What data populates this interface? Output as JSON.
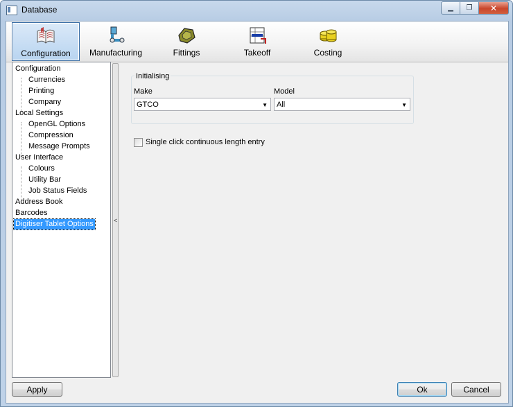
{
  "window": {
    "title": "Database"
  },
  "ribbon": {
    "items": [
      {
        "label": "Configuration",
        "icon": "book-icon",
        "active": true
      },
      {
        "label": "Manufacturing",
        "icon": "pipe-machine-icon",
        "active": false
      },
      {
        "label": "Fittings",
        "icon": "fitting-icon",
        "active": false
      },
      {
        "label": "Takeoff",
        "icon": "takeoff-icon",
        "active": false
      },
      {
        "label": "Costing",
        "icon": "coins-icon",
        "active": false
      }
    ]
  },
  "tree": {
    "items": [
      {
        "label": "Configuration",
        "level": 0
      },
      {
        "label": "Currencies",
        "level": 1
      },
      {
        "label": "Printing",
        "level": 1
      },
      {
        "label": "Company",
        "level": 1
      },
      {
        "label": "Local Settings",
        "level": 0
      },
      {
        "label": "OpenGL Options",
        "level": 1
      },
      {
        "label": "Compression",
        "level": 1
      },
      {
        "label": "Message Prompts",
        "level": 1
      },
      {
        "label": "User Interface",
        "level": 0
      },
      {
        "label": "Colours",
        "level": 1
      },
      {
        "label": "Utility Bar",
        "level": 1
      },
      {
        "label": "Job Status Fields",
        "level": 1
      },
      {
        "label": "Address Book",
        "level": 0
      },
      {
        "label": "Barcodes",
        "level": 0
      },
      {
        "label": "Digitiser Tablet Options",
        "level": 0,
        "selected": true
      }
    ]
  },
  "splitter": {
    "glyph": "<"
  },
  "initialising": {
    "title": "Initialising",
    "make_label": "Make",
    "make_value": "GTCO",
    "model_label": "Model",
    "model_value": "All"
  },
  "options": {
    "single_click_label": "Single click continuous length entry",
    "single_click_checked": false
  },
  "buttons": {
    "apply": "Apply",
    "ok": "Ok",
    "cancel": "Cancel"
  },
  "colors": {
    "selection": "#3399ff",
    "active_ribbon": "#b8d4f0"
  }
}
